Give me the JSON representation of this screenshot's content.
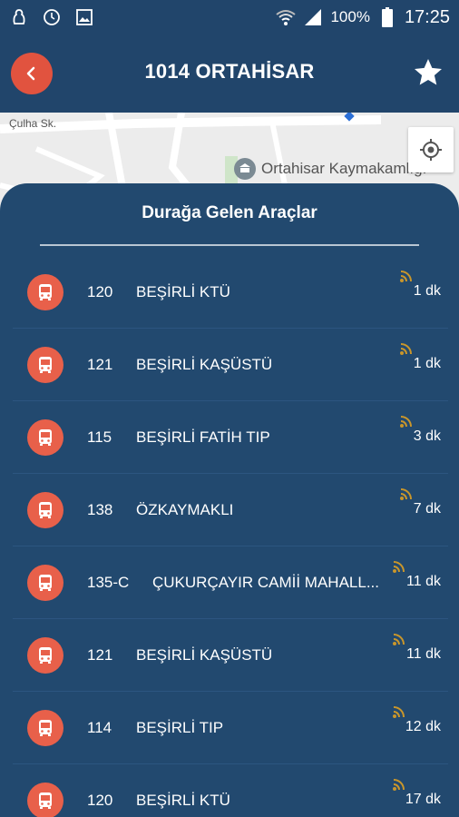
{
  "status_bar": {
    "battery": "100%",
    "time": "17:25"
  },
  "header": {
    "title": "1014 ORTAHİSAR"
  },
  "map": {
    "street_label": "Çulha Sk.",
    "poi_label": "Ortahisar Kaymakamlığı"
  },
  "panel": {
    "title": "Durağa Gelen Araçlar"
  },
  "vehicles": [
    {
      "route": "120",
      "destination": "BEŞİRLİ KTÜ",
      "eta": "1 dk"
    },
    {
      "route": "121",
      "destination": "BEŞİRLİ KAŞÜSTÜ",
      "eta": "1 dk"
    },
    {
      "route": "115",
      "destination": "BEŞİRLİ FATİH TIP",
      "eta": "3 dk"
    },
    {
      "route": "138",
      "destination": "ÖZKAYMAKLI",
      "eta": "7 dk"
    },
    {
      "route": "135-C",
      "destination": "ÇUKURÇAYIR CAMİİ MAHALL...",
      "eta": "11 dk"
    },
    {
      "route": "121",
      "destination": "BEŞİRLİ KAŞÜSTÜ",
      "eta": "11 dk"
    },
    {
      "route": "114",
      "destination": "BEŞİRLİ TIP",
      "eta": "12 dk"
    },
    {
      "route": "120",
      "destination": "BEŞİRLİ KTÜ",
      "eta": "17 dk"
    }
  ],
  "colors": {
    "background": "#22496f",
    "accent": "#e1533f",
    "bus_icon": "#e8604a",
    "live_signal": "#c9962b"
  },
  "icons": [
    "android-debug-icon",
    "clock-icon",
    "image-icon",
    "wifi-icon",
    "signal-icon",
    "battery-icon",
    "back-icon",
    "star-icon",
    "my-location-icon",
    "bus-icon",
    "live-signal-icon"
  ]
}
